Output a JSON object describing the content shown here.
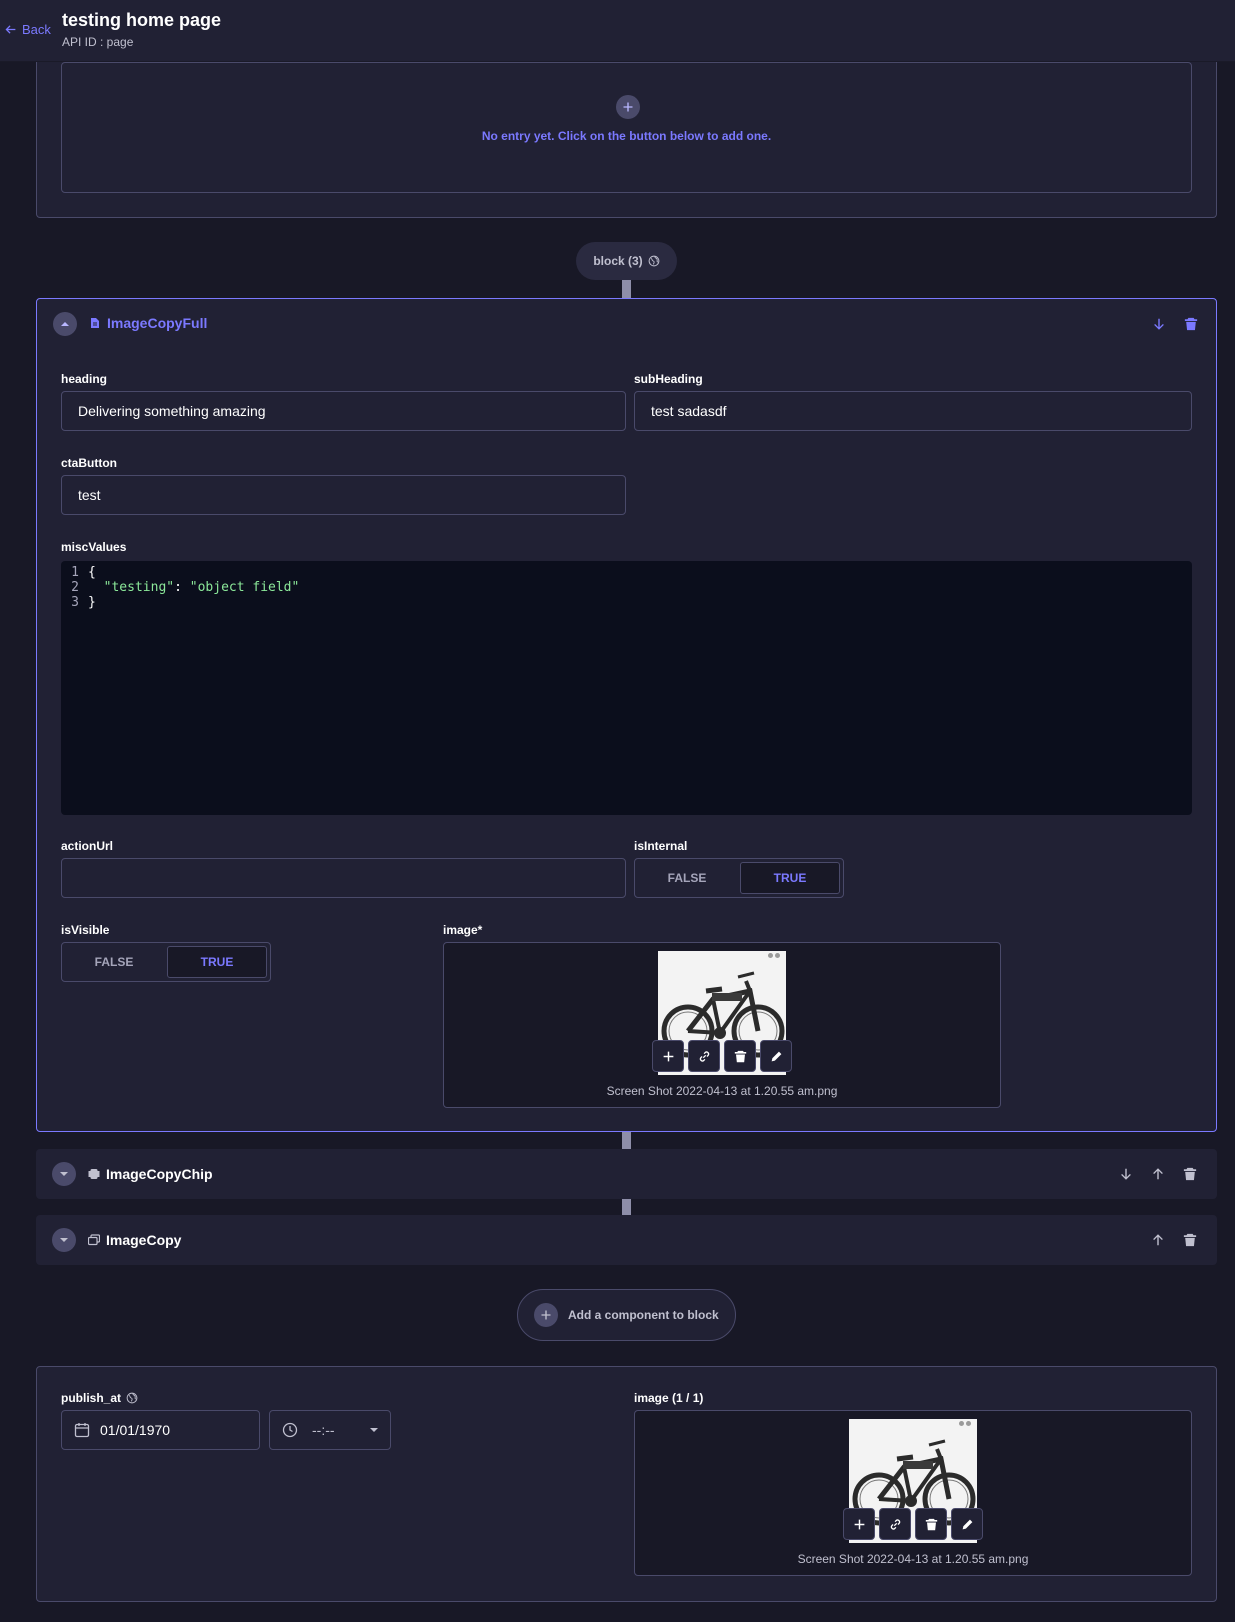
{
  "header": {
    "back_label": "Back",
    "title": "testing home page",
    "api_id": "API ID : page"
  },
  "empty_entry": {
    "message": "No entry yet. Click on the button below to add one."
  },
  "block_pill": {
    "label": "block (3)"
  },
  "components": [
    {
      "name": "ImageCopyFull",
      "expanded": true,
      "fields": {
        "heading": {
          "label": "heading",
          "value": "Delivering something amazing"
        },
        "subHeading": {
          "label": "subHeading",
          "value": "test sadasdf"
        },
        "ctaButton": {
          "label": "ctaButton",
          "value": "test"
        },
        "miscValues": {
          "label": "miscValues",
          "lines": [
            {
              "num": "1",
              "text": "{"
            },
            {
              "num": "2",
              "key": "\"testing\"",
              "sep": ": ",
              "val": "\"object field\""
            },
            {
              "num": "3",
              "text": "}"
            }
          ]
        },
        "actionUrl": {
          "label": "actionUrl",
          "value": ""
        },
        "isInternal": {
          "label": "isInternal",
          "false_label": "FALSE",
          "true_label": "TRUE",
          "selected": "TRUE"
        },
        "isVisible": {
          "label": "isVisible",
          "false_label": "FALSE",
          "true_label": "TRUE",
          "selected": "TRUE"
        },
        "image": {
          "label": "image*",
          "filename": "Screen Shot 2022-04-13 at 1.20.55 am.png"
        }
      }
    },
    {
      "name": "ImageCopyChip",
      "expanded": false
    },
    {
      "name": "ImageCopy",
      "expanded": false
    }
  ],
  "add_component": {
    "label": "Add a component to block"
  },
  "bottom": {
    "publish_at": {
      "label": "publish_at",
      "date": "01/01/1970",
      "time": "--:--"
    },
    "image": {
      "label": "image (1 / 1)",
      "filename": "Screen Shot 2022-04-13 at 1.20.55 am.png"
    }
  },
  "colors": {
    "accent": "#7b79ff",
    "background": "#181826",
    "surface": "#212134",
    "border": "#4a4a6a"
  }
}
